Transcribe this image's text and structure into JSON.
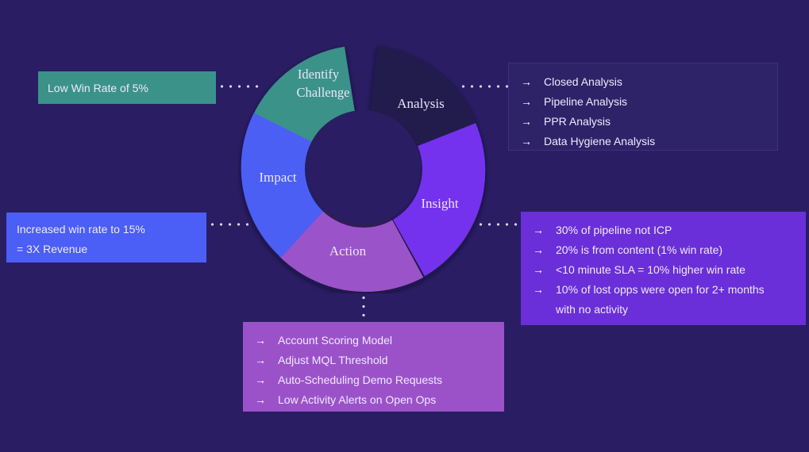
{
  "theme": {
    "background": "#2a1d63",
    "teal": "#3b9289",
    "blue": "#4b5ef5",
    "dark_navy": "#221a4d",
    "violet": "#6a2fd8",
    "orchid": "#9b52c9",
    "text": "#eeeaf8",
    "dot": "#d8d2f0"
  },
  "cycle": {
    "segments": [
      {
        "id": "identify-challenge",
        "label_line1": "Identify",
        "label_line2": "Challenge",
        "color": "#3b9289"
      },
      {
        "id": "analysis",
        "label": "Analysis",
        "color": "#221a4d"
      },
      {
        "id": "insight",
        "label": "Insight",
        "color": "#7533ee"
      },
      {
        "id": "action",
        "label": "Action",
        "color": "#9b52c9"
      },
      {
        "id": "impact",
        "label": "Impact",
        "color": "#4b5ef5"
      }
    ]
  },
  "boxes": {
    "challenge": {
      "text": "Low Win Rate of 5%"
    },
    "impact": {
      "line1": "Increased win rate to 15%",
      "line2": "= 3X Revenue"
    },
    "analysis": {
      "arrow": "→",
      "items": [
        "Closed Analysis",
        "Pipeline Analysis",
        "PPR Analysis",
        "Data Hygiene Analysis"
      ]
    },
    "insight": {
      "arrow": "→",
      "items": [
        "30% of pipeline not ICP",
        "20% is from content (1% win rate)",
        "<10 minute SLA = 10% higher win rate",
        "10% of lost opps were open for 2+ months"
      ],
      "continuation": "with no activity"
    },
    "action": {
      "arrow": "→",
      "items": [
        "Account Scoring Model",
        "Adjust MQL Threshold",
        "Auto-Scheduling Demo Requests",
        "Low Activity Alerts on Open Ops"
      ]
    }
  }
}
